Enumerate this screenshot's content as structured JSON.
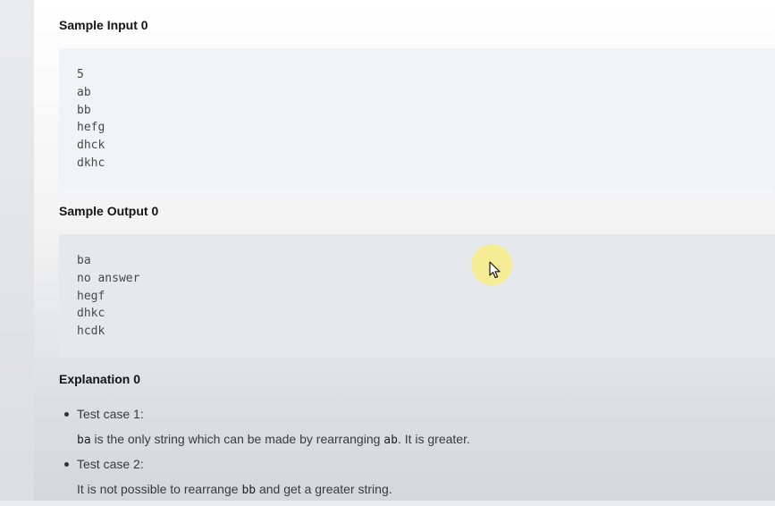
{
  "sample_input": {
    "heading": "Sample Input 0",
    "lines": [
      "5",
      "ab",
      "bb",
      "hefg",
      "dhck",
      "dkhc"
    ]
  },
  "sample_output": {
    "heading": "Sample Output 0",
    "lines": [
      "ba",
      "no answer",
      "hegf",
      "dhkc",
      "hcdk"
    ]
  },
  "explanation": {
    "heading": "Explanation 0",
    "cases": [
      {
        "title": "Test case 1:",
        "code1": "ba",
        "text1": " is the only string which can be made by rearranging ",
        "code2": "ab",
        "text2": ". It is greater."
      },
      {
        "title": "Test case 2:",
        "text0": "It is not possible to rearrange ",
        "code1": "bb",
        "text1": " and get a greater string."
      }
    ]
  },
  "colors": {
    "cursor_highlight": "#faec78",
    "input_block_bg": "#f1f4f5",
    "output_block_bg": "#e6e9eb"
  },
  "icons": {
    "cursor": "mouse-cursor-icon"
  }
}
